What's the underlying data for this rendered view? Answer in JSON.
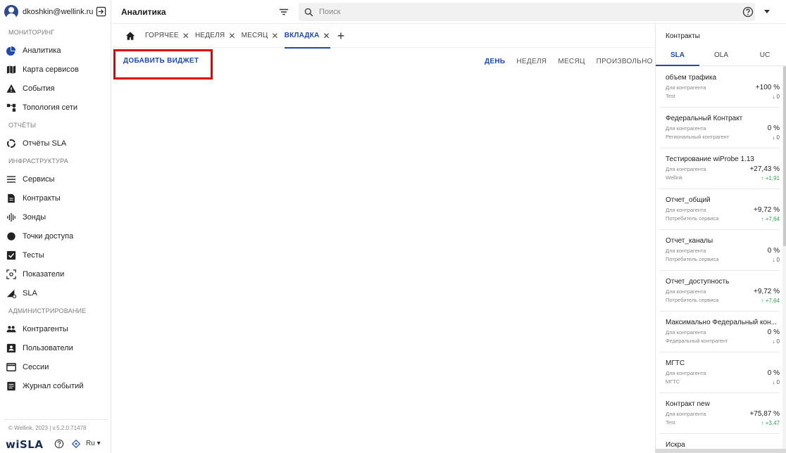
{
  "user": {
    "email": "dkoshkin@wellink.ru"
  },
  "sidebar": {
    "sections": [
      {
        "title": "МОНИТОРИНГ",
        "items": [
          {
            "label": "Аналитика",
            "icon": "analytics-icon",
            "active": true
          },
          {
            "label": "Карта сервисов",
            "icon": "map-icon"
          },
          {
            "label": "События",
            "icon": "warning-icon"
          },
          {
            "label": "Топология сети",
            "icon": "topology-icon"
          }
        ]
      },
      {
        "title": "ОТЧЁТЫ",
        "items": [
          {
            "label": "Отчёты SLA",
            "icon": "report-icon"
          }
        ]
      },
      {
        "title": "ИНФРАСТРУКТУРА",
        "items": [
          {
            "label": "Сервисы",
            "icon": "list-icon"
          },
          {
            "label": "Контракты",
            "icon": "document-icon"
          },
          {
            "label": "Зонды",
            "icon": "probe-icon"
          },
          {
            "label": "Точки доступа",
            "icon": "circle-icon"
          },
          {
            "label": "Тесты",
            "icon": "checkbox-icon"
          },
          {
            "label": "Показатели",
            "icon": "metrics-icon"
          },
          {
            "label": "SLA",
            "icon": "sla-icon"
          }
        ]
      },
      {
        "title": "АДМИНИСТРИРОВАНИЕ",
        "items": [
          {
            "label": "Контрагенты",
            "icon": "people-icon"
          },
          {
            "label": "Пользователи",
            "icon": "user-card-icon"
          },
          {
            "label": "Сессии",
            "icon": "window-icon"
          },
          {
            "label": "Журнал событий",
            "icon": "journal-icon"
          }
        ]
      }
    ],
    "version": "© Wellink, 2023 | v.5.2.0.71478",
    "brand": "wiSLA",
    "language": "Ru"
  },
  "header": {
    "title": "Аналитика",
    "search_placeholder": "Поиск"
  },
  "tabs": {
    "items": [
      {
        "label": "ГОРЯЧЕЕ",
        "active": false
      },
      {
        "label": "НЕДЕЛЯ",
        "active": false
      },
      {
        "label": "МЕСЯЦ",
        "active": false
      },
      {
        "label": "ВКЛАДКА",
        "active": true
      }
    ],
    "close": "✕",
    "add": "+"
  },
  "workspace": {
    "add_widget": "ДОБАВИТЬ ВИДЖЕТ",
    "periods": [
      {
        "label": "ДЕНЬ",
        "active": true
      },
      {
        "label": "НЕДЕЛЯ",
        "active": false
      },
      {
        "label": "МЕСЯЦ",
        "active": false
      },
      {
        "label": "ПРОИЗВОЛЬНО",
        "active": false
      }
    ]
  },
  "contracts": {
    "title": "Контракты",
    "tabs": [
      {
        "label": "SLA",
        "active": true
      },
      {
        "label": "OLA",
        "active": false
      },
      {
        "label": "UC",
        "active": false
      }
    ],
    "items": [
      {
        "name": "объем трафика",
        "kind": "Для контрагента",
        "party": "Test",
        "value": "+100 %",
        "delta": "↓ 0",
        "up": false
      },
      {
        "name": "Федеральный Контракт",
        "kind": "Для контрагента",
        "party": "Региональный контрагент",
        "value": "0 %",
        "delta": "↓ 0",
        "up": false
      },
      {
        "name": "Тестирование wiProbe 1.13",
        "kind": "Для контрагента",
        "party": "Wellink",
        "value": "+27,43 %",
        "delta": "↑ +1,91",
        "up": true
      },
      {
        "name": "Отчет_общий",
        "kind": "Для контрагента",
        "party": "Потребитель сервиса",
        "value": "+9,72 %",
        "delta": "↑ +7,64",
        "up": true
      },
      {
        "name": "Отчет_каналы",
        "kind": "Для контрагента",
        "party": "Потребитель сервиса",
        "value": "0 %",
        "delta": "↓ 0",
        "up": false
      },
      {
        "name": "Отчет_доступность",
        "kind": "Для контрагента",
        "party": "Потребитель сервиса",
        "value": "+9,72 %",
        "delta": "↑ +7,64",
        "up": true
      },
      {
        "name": "Максимально Федеральный кон...",
        "kind": "Для контрагента",
        "party": "Федеральный контрагент",
        "value": "0 %",
        "delta": "↓ 0",
        "up": false
      },
      {
        "name": "МГТС",
        "kind": "Для контрагента",
        "party": "МГТС",
        "value": "0 %",
        "delta": "↓ 0",
        "up": false
      },
      {
        "name": "Контракт new",
        "kind": "Для контрагента",
        "party": "Test",
        "value": "+75,87 %",
        "delta": "↑ +3,47",
        "up": true
      },
      {
        "name": "Искра",
        "kind": "",
        "party": "",
        "value": "",
        "delta": "",
        "up": false
      }
    ]
  }
}
